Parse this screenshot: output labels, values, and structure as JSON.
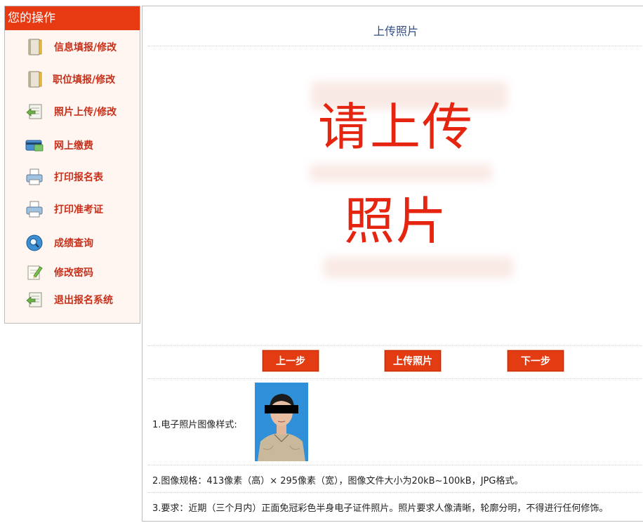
{
  "sidebar": {
    "title": "您的操作",
    "items": [
      {
        "label": "信息填报/修改",
        "icon": "notebook-icon"
      },
      {
        "label": "职位填报/修改",
        "icon": "notebook-icon"
      },
      {
        "label": "照片上传/修改",
        "icon": "document-back-icon"
      },
      {
        "label": "网上缴费",
        "icon": "payment-card-icon"
      },
      {
        "label": "打印报名表",
        "icon": "printer-icon"
      },
      {
        "label": "打印准考证",
        "icon": "printer-icon"
      },
      {
        "label": "成绩查询",
        "icon": "magnifier-icon"
      },
      {
        "label": "修改密码",
        "icon": "pencil-note-icon"
      },
      {
        "label": "退出报名系统",
        "icon": "exit-icon"
      }
    ]
  },
  "main": {
    "title": "上传照片",
    "placeholder_line1": "请上传",
    "placeholder_line2": "照片",
    "buttons": {
      "prev": "上一步",
      "upload": "上传照片",
      "next": "下一步"
    },
    "info": {
      "sample_label": "1.电子照片图像样式:",
      "spec": "2.图像规格：413像素（高）× 295像素（宽），图像文件大小为20kB~100kB，JPG格式。",
      "requirement": "3.要求：近期（三个月内）正面免冠彩色半身电子证件照片。照片要求人像清晰，轮廓分明，不得进行任何修饰。"
    }
  },
  "colors": {
    "accent": "#e83a12",
    "menu_text": "#c8301a",
    "title_text": "#2e4f86",
    "sidebar_bg": "#fff6f1"
  }
}
